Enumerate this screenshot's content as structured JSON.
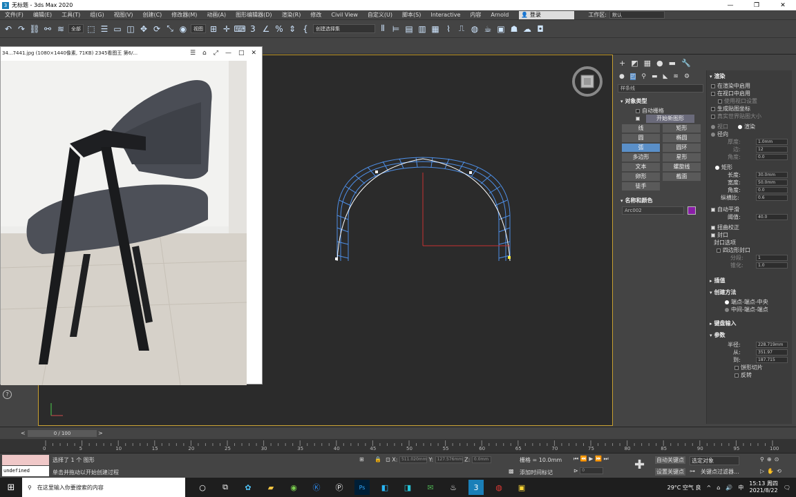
{
  "window": {
    "title": "无标题 - 3ds Max 2020",
    "controls": [
      "—",
      "❐",
      "✕"
    ]
  },
  "menu": {
    "items": [
      "文件(F)",
      "编辑(E)",
      "工具(T)",
      "组(G)",
      "视图(V)",
      "创建(C)",
      "修改器(M)",
      "动画(A)",
      "图形编辑器(D)",
      "渲染(R)",
      "修改",
      "Civil View",
      "自定义(U)",
      "脚本(S)",
      "Interactive",
      "内容",
      "Arnold"
    ],
    "login": "登录",
    "workspace_label": "工作区:",
    "workspace_value": "默认"
  },
  "toolbar": {
    "filter": "全部",
    "view_ref": "视图",
    "selection_set": "创建选择集"
  },
  "image_viewer": {
    "title": "34...7441.jpg  (1080×1440像素, 71KB)  2345看图王  第6/..."
  },
  "command_panel": {
    "category": "样条线",
    "object_type_header": "对象类型",
    "auto_grid": "自动栅格",
    "start_new_shape": "开始新图形",
    "buttons": [
      "线",
      "矩形",
      "圆",
      "椭圆",
      "弧",
      "圆环",
      "多边形",
      "星形",
      "文本",
      "螺旋线",
      "卵形",
      "截面",
      "徒手"
    ],
    "active_button": "弧",
    "name_color_header": "名称和颜色",
    "object_name": "Arc002",
    "object_color": "#8a1ea8"
  },
  "rendering": {
    "header": "渲染",
    "enable_in_renderer": "在渲染中启用",
    "enable_in_viewport": "在视口中启用",
    "use_viewport_settings": "使用视口设置",
    "generate_mapping": "生成贴图坐标",
    "real_world_map_size": "真实世界贴图大小",
    "viewport_label": "视口",
    "render_label": "渲染",
    "radial_label": "径向",
    "thickness_label": "厚度:",
    "thickness_value": "1.0mm",
    "sides_label": "边:",
    "sides_value": "12",
    "angle_label": "角度:",
    "angle_value": "0.0",
    "rectangular_label": "矩形",
    "length_label": "长度:",
    "length_value": "30.0mm",
    "width_label": "宽度:",
    "width_value": "50.0mm",
    "angle2_label": "角度:",
    "angle2_value": "0.0",
    "aspect_label": "纵横比:",
    "aspect_value": "0.6",
    "auto_smooth": "自动平滑",
    "threshold_label": "阈值:",
    "threshold_value": "40.0",
    "torsion_correction": "扭曲校正",
    "cap": "封口",
    "cap_options_header": "封口选项",
    "quad_cap": "四边形封口",
    "subdiv_label": "分段:",
    "subdiv_value": "1",
    "taper_label": "锥化:",
    "taper_value": "1.0"
  },
  "interpolation": {
    "header": "插值"
  },
  "creation_method": {
    "header": "创建方法",
    "end_end_middle": "端点-端点-中央",
    "center_end_end": "中间-端点-端点"
  },
  "keyboard_entry": {
    "header": "键盘输入"
  },
  "parameters": {
    "header": "参数",
    "radius_label": "半径:",
    "radius_value": "228.719mm",
    "from_label": "从:",
    "from_value": "351.97",
    "to_label": "到:",
    "to_value": "187.715",
    "pie_slice": "饼形切片",
    "reverse": "反转"
  },
  "timeline": {
    "slider": "0 / 100",
    "ticks": [
      "0",
      "5",
      "10",
      "15",
      "20",
      "25",
      "30",
      "35",
      "40",
      "45",
      "50",
      "55",
      "60",
      "65",
      "70",
      "75",
      "80",
      "85",
      "90",
      "95",
      "100"
    ]
  },
  "status": {
    "maxscript": "undefined",
    "selected": "选择了 1 个 图形",
    "prompt": "单击并拖动以开始创建过程",
    "x_label": "X:",
    "x_value": "511.020mm",
    "y_label": "Y:",
    "y_value": "127.576mm",
    "z_label": "Z:",
    "z_value": "0.0mm",
    "grid": "栅格 = 10.0mm",
    "add_time_tag": "添加时间标记",
    "auto_key": "自动关键点",
    "set_key": "设置关键点",
    "selected_objects": "选定对象",
    "key_filters": "关键点过滤器...",
    "frame": "0"
  },
  "taskbar": {
    "search_placeholder": "在这里输入你要搜索的内容",
    "weather": "29°C 空气 良",
    "time": "15:13 周四",
    "date": "2021/8/22",
    "language": "中"
  }
}
